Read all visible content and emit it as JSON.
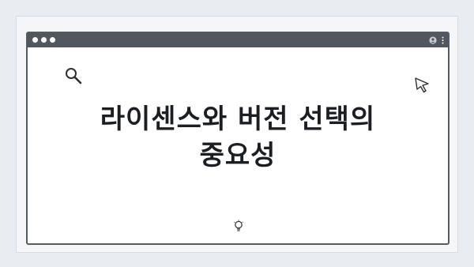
{
  "headline": {
    "line1": "라이센스와 버전 선택의",
    "line2": "중요성"
  },
  "icons": {
    "search": "search-icon",
    "cursor": "cursor-arrow-icon",
    "idea": "lightbulb-icon",
    "profile": "profile-icon",
    "menu": "more-vertical-icon"
  },
  "colors": {
    "background": "#e8edf2",
    "titlebar": "#51575e",
    "text": "#1b1f24"
  }
}
